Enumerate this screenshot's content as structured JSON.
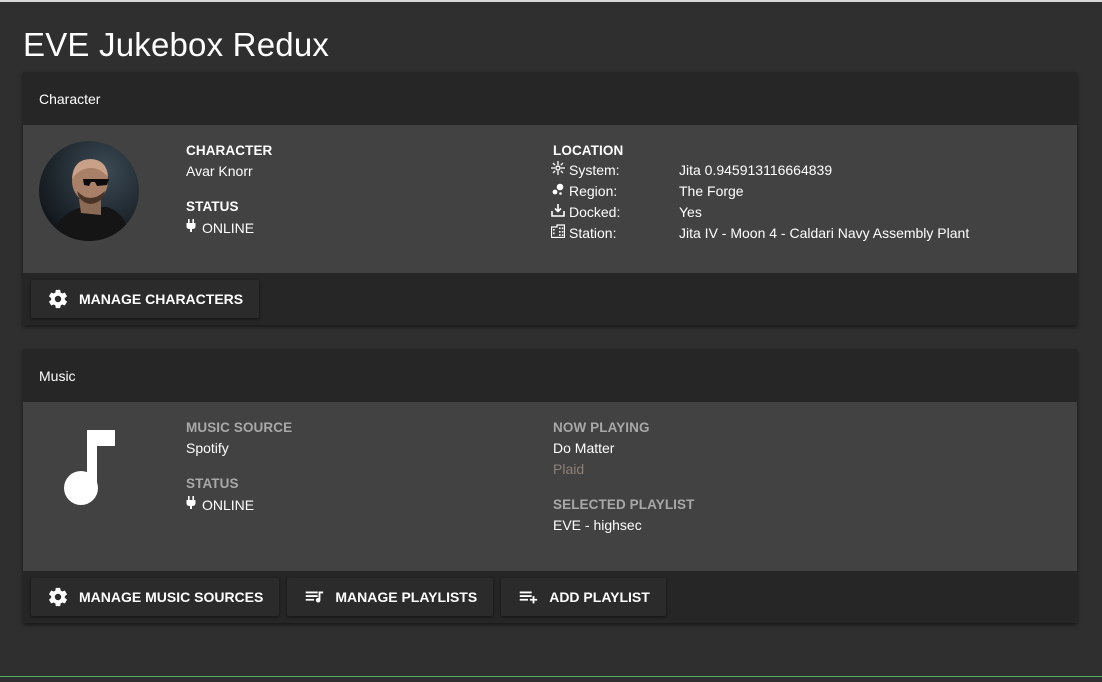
{
  "app": {
    "title": "EVE Jukebox Redux"
  },
  "character_card": {
    "header": "Character",
    "character_label": "CHARACTER",
    "character_name": "Avar Knorr",
    "status_label": "STATUS",
    "status_value": "ONLINE",
    "status_icon": "power-plug-icon",
    "location_label": "LOCATION",
    "location": [
      {
        "key": "System:",
        "value": "Jita 0.945913116664839",
        "icon": "star-icon"
      },
      {
        "key": "Region:",
        "value": "The Forge",
        "icon": "map-marker-group-icon"
      },
      {
        "key": "Docked:",
        "value": "Yes",
        "icon": "tray-download-icon"
      },
      {
        "key": "Station:",
        "value": "Jita IV - Moon 4 - Caldari Navy Assembly Plant",
        "icon": "office-building-icon"
      }
    ],
    "manage_button": "MANAGE CHARACTERS"
  },
  "music_card": {
    "header": "Music",
    "source_label": "MUSIC SOURCE",
    "source_value": "Spotify",
    "status_label": "STATUS",
    "status_value": "ONLINE",
    "now_playing_label": "NOW PLAYING",
    "track": "Do Matter",
    "artist": "Plaid",
    "playlist_label": "SELECTED PLAYLIST",
    "playlist_value": "EVE - highsec",
    "buttons": {
      "manage_sources": "MANAGE MUSIC SOURCES",
      "manage_playlists": "MANAGE PLAYLISTS",
      "add_playlist": "ADD PLAYLIST"
    }
  },
  "colors": {
    "page_bg": "#2f2f2f",
    "card_header_bg": "#262626",
    "card_body_bg": "#424242",
    "muted_label": "#a8a8a8",
    "artist_text": "#8e8078",
    "footer_accent": "#4fae62"
  }
}
